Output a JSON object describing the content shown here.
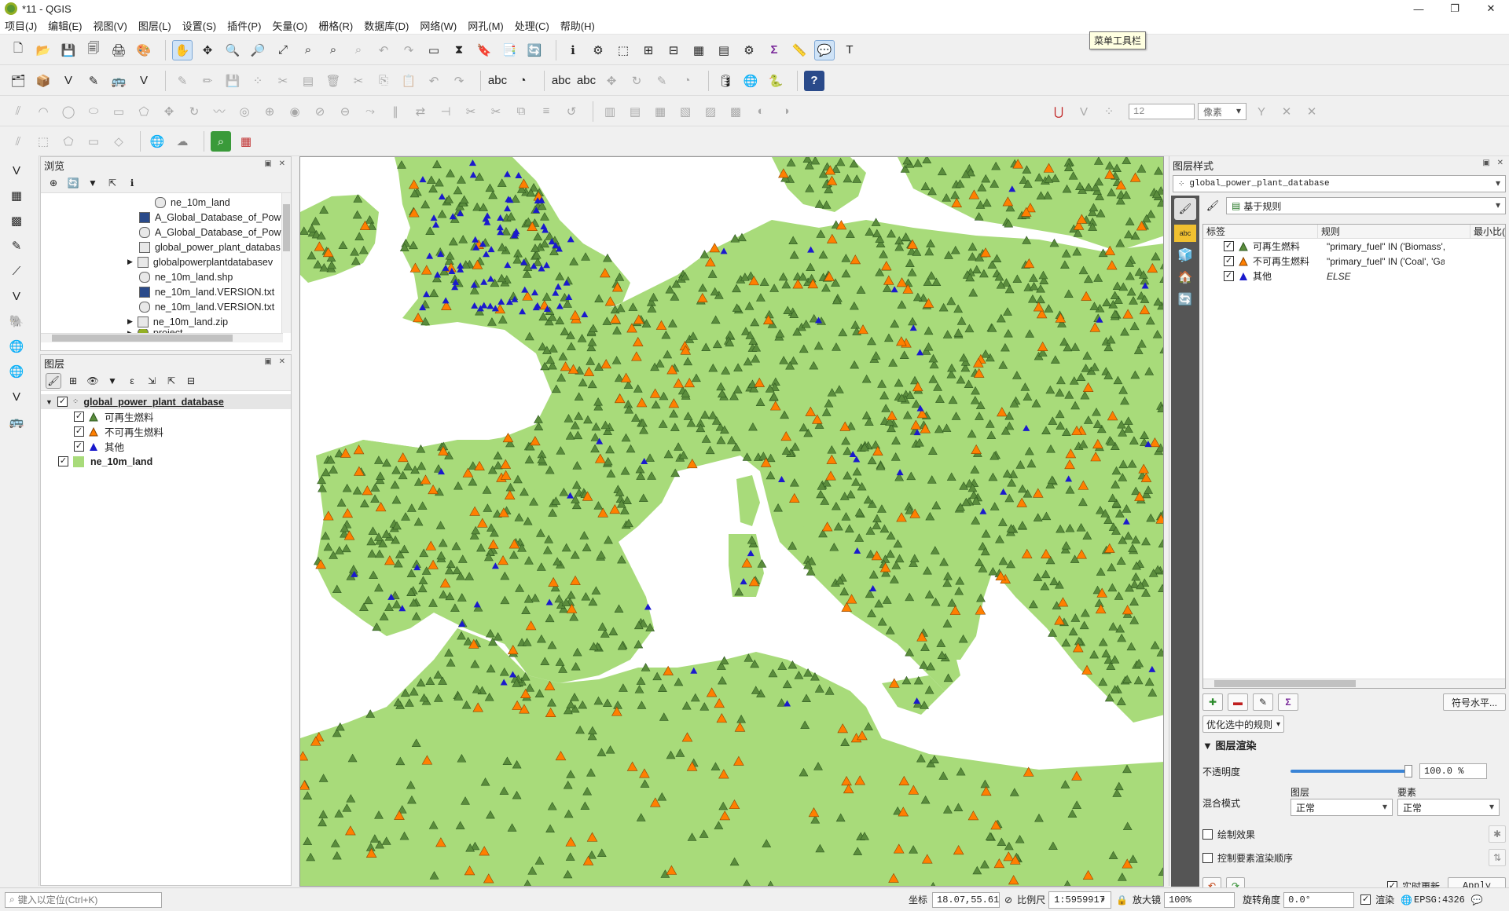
{
  "window": {
    "title": "*11 - QGIS",
    "controls": [
      "—",
      "❐",
      "✕"
    ]
  },
  "menu": [
    "项目(J)",
    "编辑(E)",
    "视图(V)",
    "图层(L)",
    "设置(S)",
    "插件(P)",
    "矢量(O)",
    "栅格(R)",
    "数据库(D)",
    "网络(W)",
    "网孔(M)",
    "处理(C)",
    "帮助(H)"
  ],
  "tooltip": "菜单工具栏",
  "toolbar2": {
    "digitize_size_value": "12",
    "unit_value": "像素"
  },
  "browser": {
    "title": "浏览",
    "items": [
      "ne_10m_land",
      "A_Global_Database_of_Powe",
      "A_Global_Database_of_Powe",
      "global_power_plant_databas",
      "globalpowerplantdatabasev",
      "ne_10m_land.shp",
      "ne_10m_land.VERSION.txt",
      "ne_10m_land.VERSION.txt",
      "ne_10m_land.zip",
      "project"
    ]
  },
  "layers": {
    "title": "图层",
    "items": [
      {
        "name": "global_power_plant_database",
        "checked": true,
        "bold": true
      },
      {
        "name": "可再生燃料",
        "checked": true,
        "symbol_color": "#5a8c3c"
      },
      {
        "name": "不可再生燃料",
        "checked": true,
        "symbol_color": "#ff7f00"
      },
      {
        "name": "其他",
        "checked": true,
        "symbol_color": "#1a1acc"
      },
      {
        "name": "ne_10m_land",
        "checked": true,
        "bold": true,
        "symbol_color": "#a8db7a"
      }
    ]
  },
  "style": {
    "title": "图层样式",
    "layer_select": "global_power_plant_database",
    "renderer": "基于规则",
    "columns": [
      "标签",
      "规则",
      "最小比("
    ],
    "rules": [
      {
        "label": "可再生燃料",
        "rule": "\"primary_fuel\" IN ('Biomass', '...",
        "color": "#5a8c3c"
      },
      {
        "label": "不可再生燃料",
        "rule": "\"primary_fuel\" IN ('Coal', 'Gas'...",
        "color": "#ff7f00"
      },
      {
        "label": "其他",
        "rule": "ELSE",
        "color": "#1a1acc"
      }
    ],
    "symbol_levels_button": "符号水平...",
    "refine_button": "优化选中的规则",
    "rendering_section": "图层渲染",
    "opacity_label": "不透明度",
    "opacity_value": "100.0 %",
    "blend_label": "混合模式",
    "blend_layer_label": "图层",
    "blend_layer_value": "正常",
    "blend_feature_label": "要素",
    "blend_feature_value": "正常",
    "draw_effects": "绘制效果",
    "control_order": "控制要素渲染顺序",
    "live_update": "实时更新",
    "apply": "Apply"
  },
  "status": {
    "locator_placeholder": "键入以定位(Ctrl+K)",
    "coord_label": "坐标",
    "coord_value": "18.07,55.61",
    "scale_label": "比例尺",
    "scale_value": "1:5959917",
    "magnifier_label": "放大镜",
    "magnifier_value": "100%",
    "rotation_label": "旋转角度",
    "rotation_value": "0.0°",
    "render_label": "渲染",
    "crs": "EPSG:4326"
  },
  "map": {
    "land_color": "#a8db7a",
    "green_tri": "#5a8c3c",
    "orange_tri": "#ff7f00",
    "blue_tri": "#1a1acc"
  }
}
